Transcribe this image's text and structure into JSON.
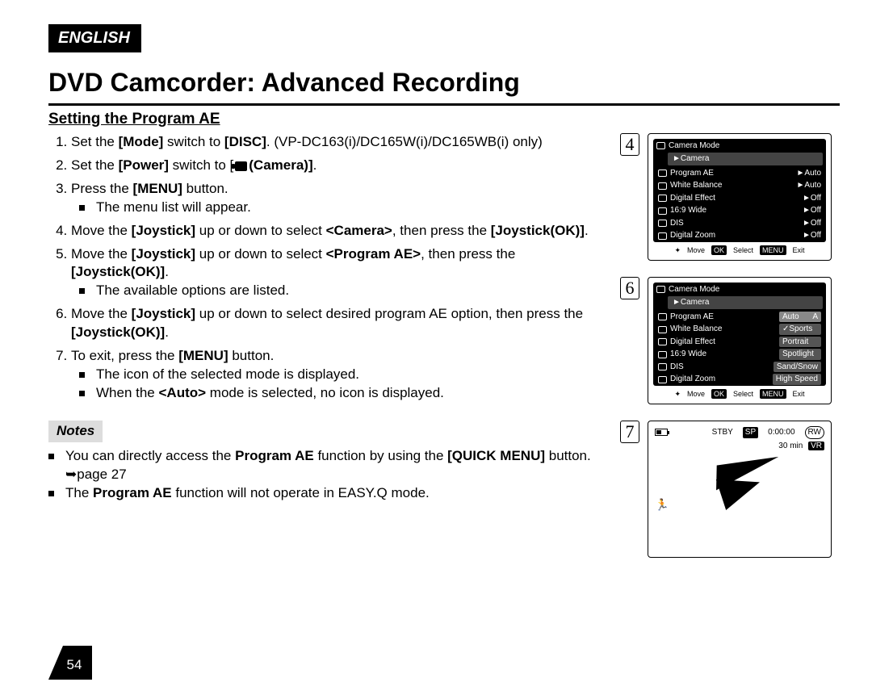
{
  "lang": "ENGLISH",
  "title": "DVD Camcorder: Advanced Recording",
  "section": "Setting the Program AE",
  "page_num": "54",
  "steps": {
    "s1_a": "Set the ",
    "s1_b": "[Mode]",
    "s1_c": " switch to ",
    "s1_d": "[DISC]",
    "s1_e": ". (VP-DC163(i)/DC165W(i)/DC165WB(i) only)",
    "s2_a": "Set the ",
    "s2_b": "[Power]",
    "s2_c": " switch to  [",
    "s2_d": "(Camera)]",
    "s2_e": ".",
    "s3_a": "Press the ",
    "s3_b": "[MENU]",
    "s3_c": " button.",
    "s3_sub": "The menu list will appear.",
    "s4_a": "Move the ",
    "s4_b": "[Joystick]",
    "s4_c": " up or down to select ",
    "s4_d": "<Camera>",
    "s4_e": ", then press the ",
    "s4_f": "[Joystick(OK)]",
    "s4_g": ".",
    "s5_a": "Move the ",
    "s5_b": "[Joystick]",
    "s5_c": " up or down to select ",
    "s5_d": "<Program AE>",
    "s5_e": ", then press the ",
    "s5_f": "[Joystick(OK)]",
    "s5_g": ".",
    "s5_sub": "The available options are listed.",
    "s6_a": "Move the ",
    "s6_b": "[Joystick]",
    "s6_c": " up or down to select desired program AE option, then press the ",
    "s6_d": "[Joystick(OK)]",
    "s6_e": ".",
    "s7_a": "To exit, press the ",
    "s7_b": "[MENU]",
    "s7_c": " button.",
    "s7_sub1": "The icon of the selected mode is displayed.",
    "s7_sub2_a": "When the ",
    "s7_sub2_b": "<Auto>",
    "s7_sub2_c": " mode is selected, no icon is displayed."
  },
  "notes_label": "Notes",
  "notes": {
    "n1_a": "You can directly access the ",
    "n1_b": "Program AE",
    "n1_c": " function by using the ",
    "n1_d": "[QUICK MENU]",
    "n1_e": " button. ",
    "n1_f": "➥page 27",
    "n2_a": "The ",
    "n2_b": "Program AE",
    "n2_c": " function will not operate in EASY.Q mode."
  },
  "fig4": {
    "num": "4",
    "title": "Camera Mode",
    "breadcrumb": "►Camera",
    "rows": [
      {
        "label": "Program AE",
        "val": "►Auto"
      },
      {
        "label": "White Balance",
        "val": "►Auto"
      },
      {
        "label": "Digital Effect",
        "val": "►Off"
      },
      {
        "label": "16:9 Wide",
        "val": "►Off"
      },
      {
        "label": "DIS",
        "val": "►Off"
      },
      {
        "label": "Digital Zoom",
        "val": "►Off"
      }
    ],
    "ctrls": {
      "move": "Move",
      "select": "Select",
      "menu": "MENU",
      "exit": "Exit",
      "ok": "OK"
    }
  },
  "fig6": {
    "num": "6",
    "title": "Camera Mode",
    "breadcrumb": "►Camera",
    "rows": [
      {
        "label": "Program AE",
        "val": "Auto",
        "tag": "A"
      },
      {
        "label": "White Balance",
        "val": "✓Sports",
        "tag": ""
      },
      {
        "label": "Digital Effect",
        "val": "Portrait",
        "tag": ""
      },
      {
        "label": "16:9 Wide",
        "val": "Spotlight",
        "tag": ""
      },
      {
        "label": "DIS",
        "val": "Sand/Snow",
        "tag": ""
      },
      {
        "label": "Digital Zoom",
        "val": "High Speed",
        "tag": ""
      }
    ],
    "ctrls": {
      "move": "Move",
      "select": "Select",
      "menu": "MENU",
      "exit": "Exit",
      "ok": "OK"
    }
  },
  "fig7": {
    "num": "7",
    "stby": "STBY",
    "sp": "SP",
    "time": "0:00:00",
    "rw": "RW",
    "min": "30 min",
    "vr": "VR"
  }
}
